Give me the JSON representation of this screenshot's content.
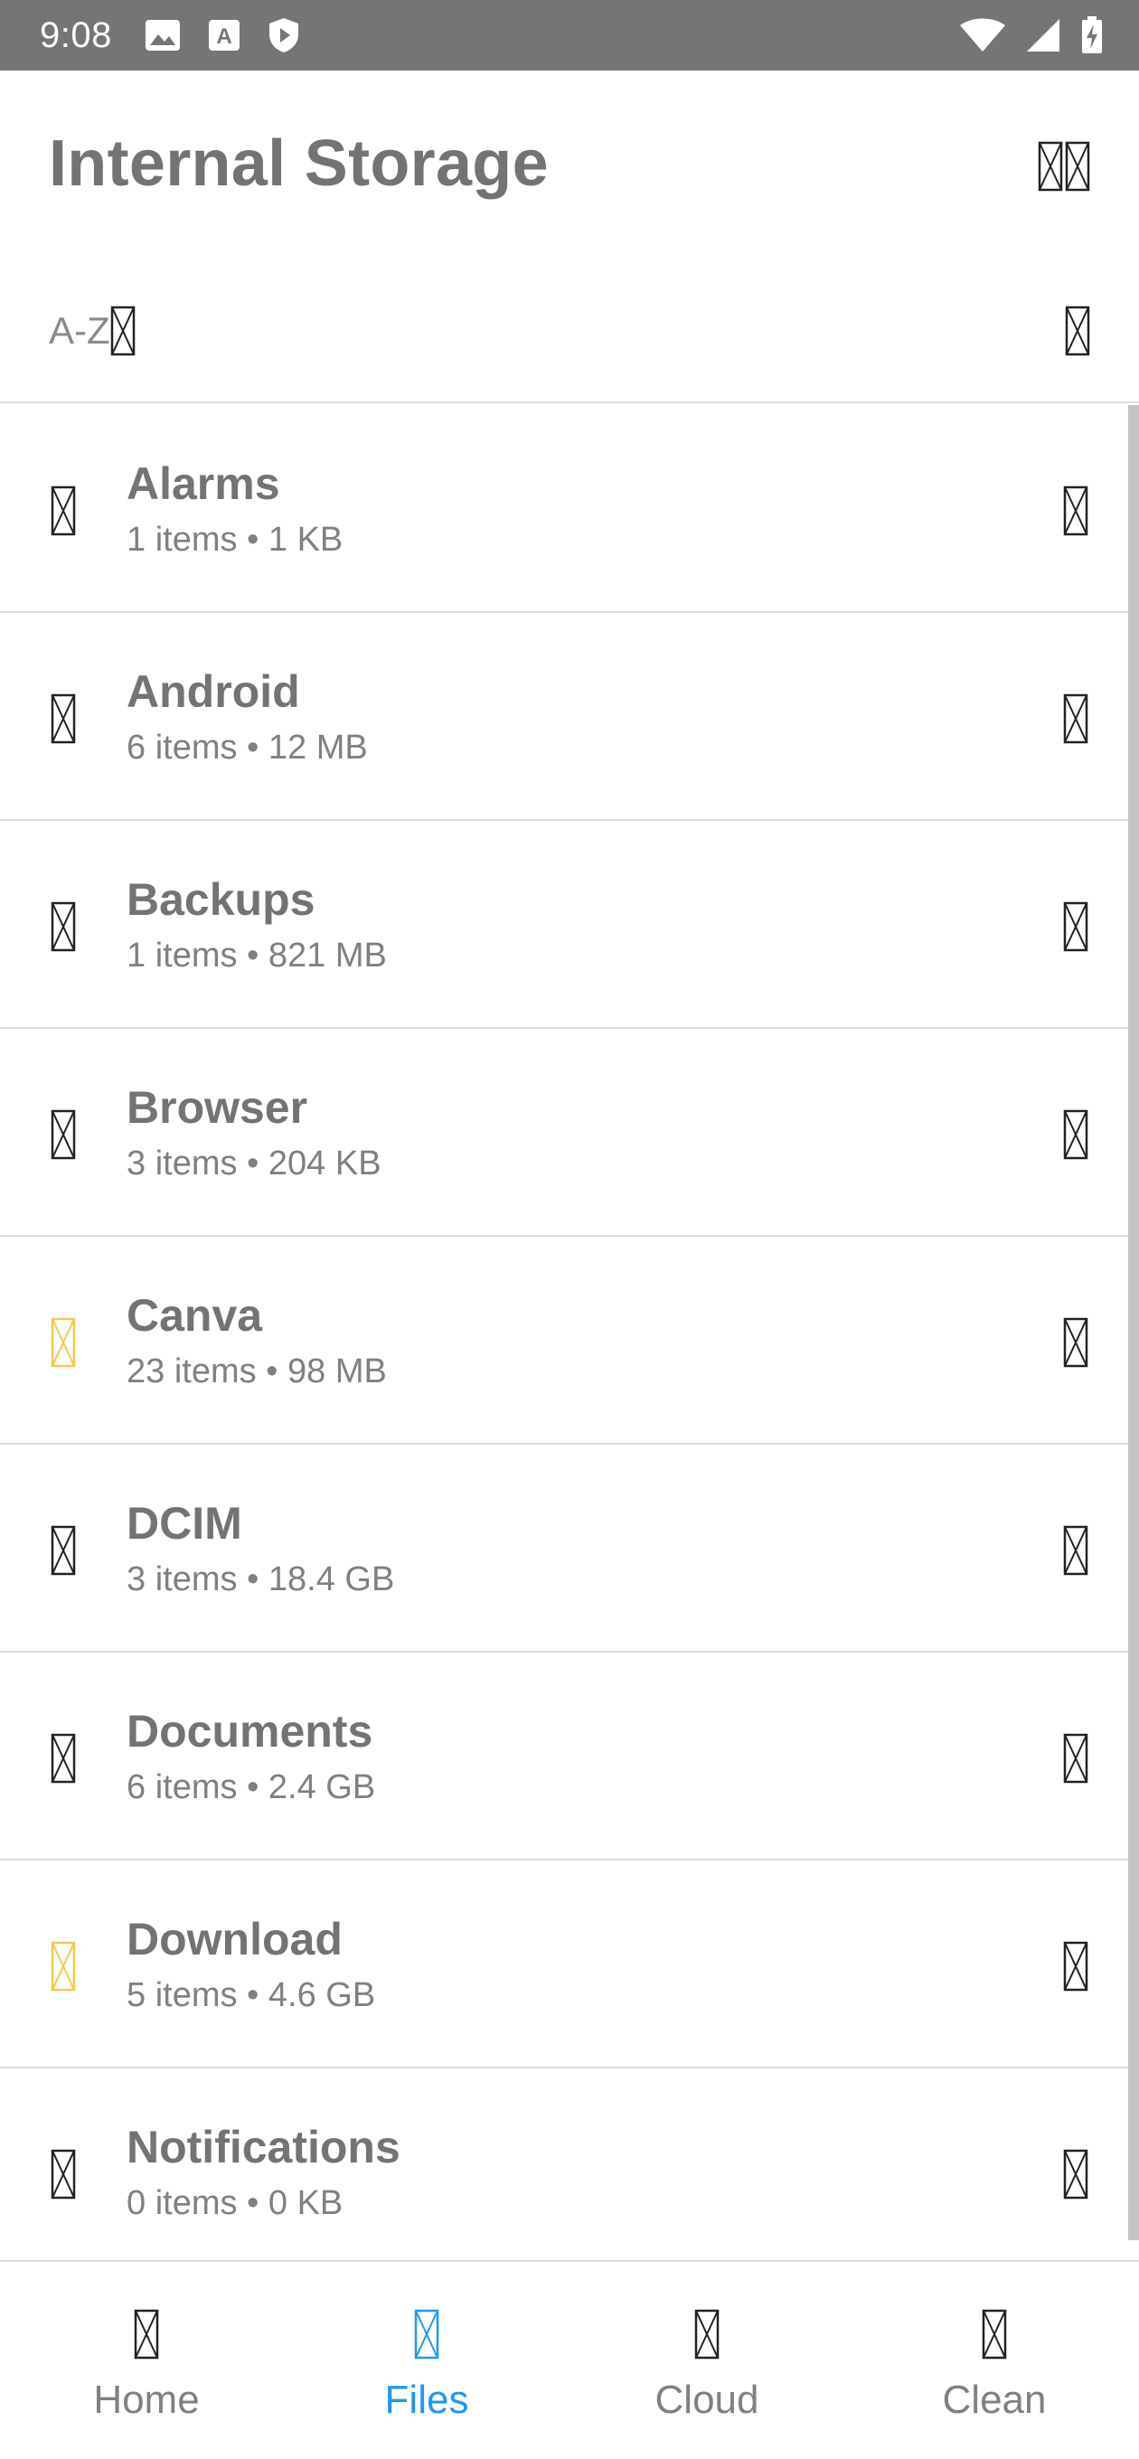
{
  "status_bar": {
    "time": "9:08",
    "left_icons": [
      "image-icon",
      "font-download-icon",
      "shield-play-icon"
    ],
    "right_icons": [
      "wifi-icon",
      "cellular-signal-icon",
      "battery-charging-icon"
    ]
  },
  "header": {
    "title": "Internal Storage",
    "action_icons": [
      "search-icon",
      "more-icon"
    ]
  },
  "sort": {
    "label": "A-Z",
    "sort_icon": "sort-arrow-icon",
    "right_icon": "view-toggle-icon"
  },
  "files": [
    {
      "name": "Alarms",
      "meta": "1 items • 1 KB",
      "icon": "folder-icon",
      "icon_color": "#222222"
    },
    {
      "name": "Android",
      "meta": "6 items • 12 MB",
      "icon": "folder-icon",
      "icon_color": "#222222"
    },
    {
      "name": "Backups",
      "meta": "1 items • 821 MB",
      "icon": "folder-icon",
      "icon_color": "#222222"
    },
    {
      "name": "Browser",
      "meta": "3 items • 204 KB",
      "icon": "folder-icon",
      "icon_color": "#222222"
    },
    {
      "name": "Canva",
      "meta": "23 items • 98 MB",
      "icon": "folder-icon",
      "icon_color": "#f2c94c"
    },
    {
      "name": "DCIM",
      "meta": "3 items • 18.4 GB",
      "icon": "folder-icon",
      "icon_color": "#222222"
    },
    {
      "name": "Documents",
      "meta": "6 items • 2.4 GB",
      "icon": "folder-icon",
      "icon_color": "#222222"
    },
    {
      "name": "Download",
      "meta": "5 items • 4.6 GB",
      "icon": "folder-icon",
      "icon_color": "#f2c94c"
    },
    {
      "name": "Notifications",
      "meta": "0 items • 0 KB",
      "icon": "folder-icon",
      "icon_color": "#222222"
    }
  ],
  "bottom_nav": {
    "items": [
      {
        "label": "Home",
        "icon": "home-icon",
        "active": false
      },
      {
        "label": "Files",
        "icon": "files-icon",
        "active": true
      },
      {
        "label": "Cloud",
        "icon": "cloud-icon",
        "active": false
      },
      {
        "label": "Clean",
        "icon": "clean-icon",
        "active": false
      }
    ]
  },
  "colors": {
    "accent": "#2196f3",
    "status_bar": "#757575",
    "text_primary": "#737373",
    "text_secondary": "#808080",
    "highlight_folder": "#f2c94c"
  }
}
